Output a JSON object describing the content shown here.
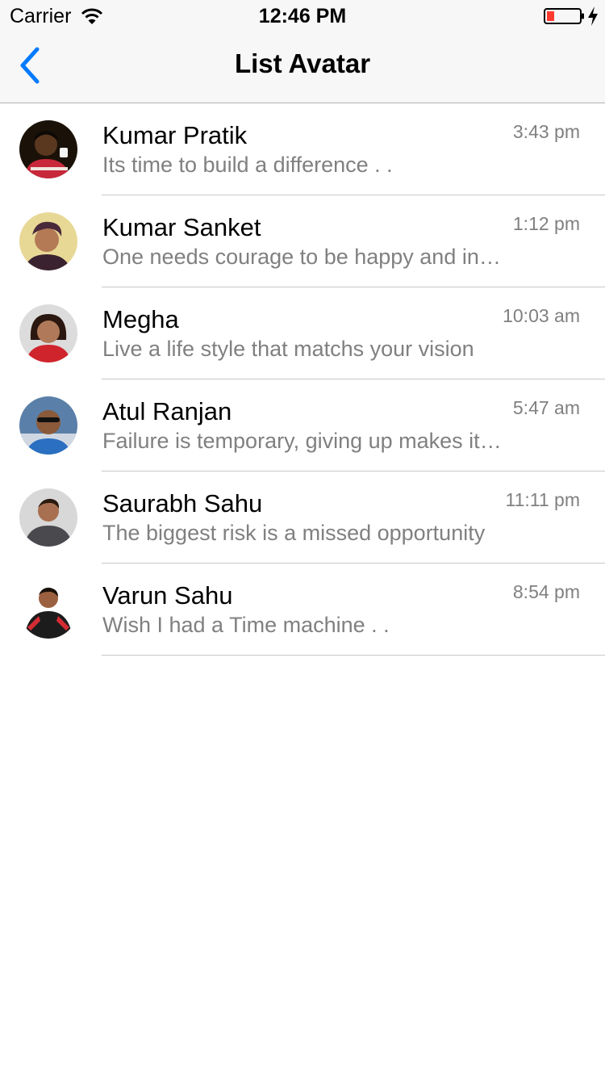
{
  "status_bar": {
    "carrier": "Carrier",
    "time": "12:46 PM"
  },
  "nav": {
    "title": "List Avatar",
    "accent_color": "#007aff"
  },
  "contacts": [
    {
      "name": "Kumar Pratik",
      "message": "Its time to build a difference . .",
      "time": "3:43 pm"
    },
    {
      "name": "Kumar Sanket",
      "message": "One needs courage to be happy and in love",
      "time": "1:12 pm"
    },
    {
      "name": "Megha",
      "message": "Live a life style that matchs your vision",
      "time": "10:03 am"
    },
    {
      "name": "Atul Ranjan",
      "message": "Failure is temporary, giving up makes it permanent",
      "time": "5:47 am"
    },
    {
      "name": "Saurabh Sahu",
      "message": "The biggest risk is a missed opportunity",
      "time": "11:11 pm"
    },
    {
      "name": "Varun Sahu",
      "message": "Wish I had a Time machine . .",
      "time": "8:54 pm"
    }
  ]
}
